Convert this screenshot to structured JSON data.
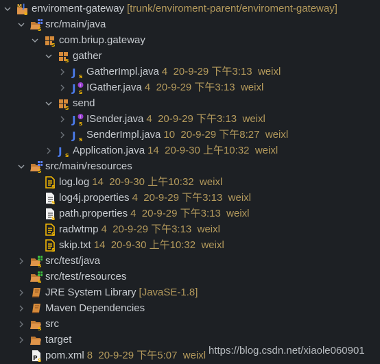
{
  "project_explorer": {
    "rows": [
      {
        "name": "enviroment-gateway",
        "deco": "[trunk/enviroment-parent/enviroment-gateway]",
        "icon": "maven-project-icon",
        "expanded": true
      },
      {
        "name": "src/main/java",
        "deco": "",
        "icon": "source-folder-icon",
        "expanded": true
      },
      {
        "name": "com.briup.gateway",
        "deco": "",
        "icon": "package-icon",
        "expanded": true
      },
      {
        "name": "gather",
        "deco": "",
        "icon": "package-icon",
        "expanded": true
      },
      {
        "name": "GatherImpl.java",
        "deco": "4  20-9-29 下午3:13  weixl",
        "icon": "java-class-icon",
        "expanded": false
      },
      {
        "name": "IGather.java",
        "deco": "4  20-9-29 下午3:13  weixl",
        "icon": "java-interface-icon",
        "expanded": false
      },
      {
        "name": "send",
        "deco": "",
        "icon": "package-icon",
        "expanded": true
      },
      {
        "name": "ISender.java",
        "deco": "4  20-9-29 下午3:13  weixl",
        "icon": "java-interface-icon",
        "expanded": false
      },
      {
        "name": "SenderImpl.java",
        "deco": "10  20-9-29 下午8:27  weixl",
        "icon": "java-class-icon",
        "expanded": false
      },
      {
        "name": "Application.java",
        "deco": "14  20-9-30 上午10:32  weixl",
        "icon": "java-class-icon",
        "expanded": false
      },
      {
        "name": "src/main/resources",
        "deco": "",
        "icon": "source-folder-icon",
        "expanded": true
      },
      {
        "name": "log.log",
        "deco": "14  20-9-30 上午10:32  weixl",
        "icon": "text-file-icon",
        "expanded": null
      },
      {
        "name": "log4j.properties",
        "deco": "4  20-9-29 下午3:13  weixl",
        "icon": "properties-file-icon",
        "expanded": null
      },
      {
        "name": "path.properties",
        "deco": "4  20-9-29 下午3:13  weixl",
        "icon": "properties-file-icon",
        "expanded": null
      },
      {
        "name": "radwtmp",
        "deco": "4  20-9-29 下午3:13  weixl",
        "icon": "text-file-icon",
        "expanded": null
      },
      {
        "name": "skip.txt",
        "deco": "14  20-9-30 上午10:32  weixl",
        "icon": "text-file-icon",
        "expanded": null
      },
      {
        "name": "src/test/java",
        "deco": "",
        "icon": "test-source-folder-icon",
        "expanded": false
      },
      {
        "name": "src/test/resources",
        "deco": "",
        "icon": "test-source-folder-icon",
        "expanded": null
      },
      {
        "name": "JRE System Library",
        "deco": "[JavaSE-1.8]",
        "icon": "library-icon",
        "expanded": false
      },
      {
        "name": "Maven Dependencies",
        "deco": "",
        "icon": "library-icon",
        "expanded": false
      },
      {
        "name": "src",
        "deco": "",
        "icon": "folder-svn-icon",
        "expanded": false
      },
      {
        "name": "target",
        "deco": "",
        "icon": "folder-icon",
        "expanded": false
      },
      {
        "name": "pom.xml",
        "deco": "8  20-9-29 下午5:07  weixl",
        "icon": "pom-file-icon",
        "expanded": null
      }
    ]
  },
  "watermark": "https://blog.csdn.net/xiaole060901"
}
